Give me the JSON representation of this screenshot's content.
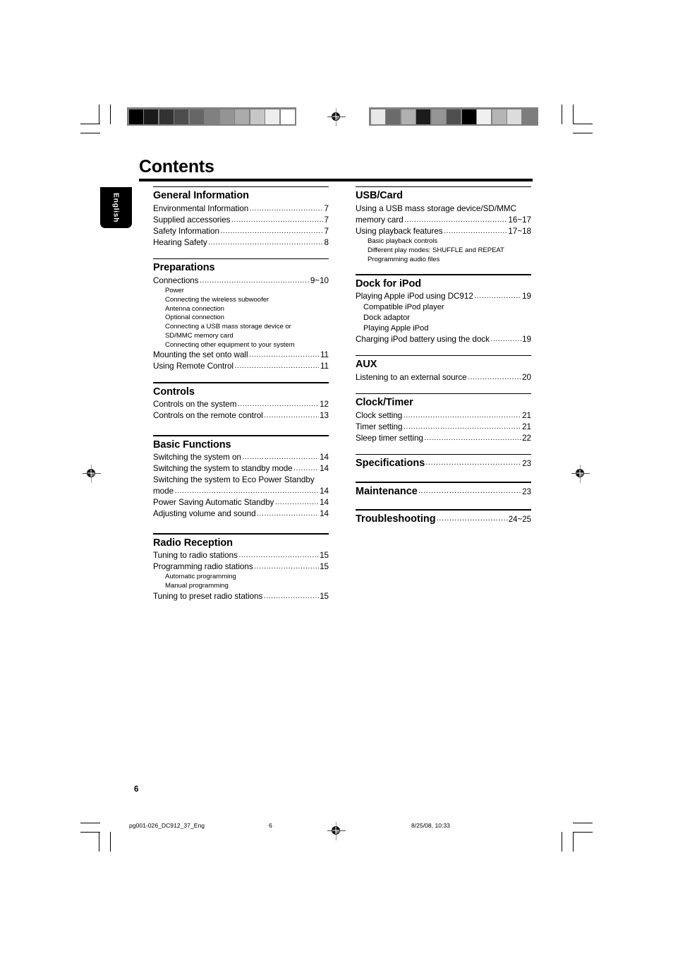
{
  "document": {
    "page_title": "Contents",
    "language_tab": "English",
    "folio": "6"
  },
  "marks": {
    "registration_icon": "registration-target-icon",
    "density_bar_left": [
      "#000000",
      "#1b1b1b",
      "#333333",
      "#4d4d4d",
      "#666666",
      "#808080",
      "#949494",
      "#ababab",
      "#c6c6c6",
      "#ededed",
      "#ffffff"
    ],
    "density_bar_right": [
      "#e8e8e8",
      "#6b6b6b",
      "#b0b0b0",
      "#1c1c1c",
      "#959595",
      "#4f4f4f",
      "#000000",
      "#f0f0f0",
      "#b5b5b5",
      "#dcdcdc",
      "#7d7d7d"
    ]
  },
  "toc": {
    "left_column": [
      {
        "heading": "General Information",
        "entries": [
          {
            "label": "Environmental Information",
            "page": "7"
          },
          {
            "label": "Supplied accessories",
            "page": "7"
          },
          {
            "label": "Safety Information",
            "page": "7"
          },
          {
            "label": "Hearing Safety",
            "page": "8"
          }
        ]
      },
      {
        "heading": "Preparations",
        "entries": [
          {
            "label": "Connections",
            "page": "9~10"
          }
        ],
        "sub_after_first": [
          "Power",
          "Connecting the wireless subwoofer",
          "Antenna connection",
          "Optional connection",
          "Connecting a USB mass storage device or",
          "SD/MMC memory card",
          "Connecting other equipment to your system"
        ],
        "entries_tail": [
          {
            "label": "Mounting the set onto wall",
            "page": "11"
          },
          {
            "label": "Using Remote Control",
            "page": "11"
          }
        ]
      },
      {
        "heading": "Controls",
        "entries": [
          {
            "label": "Controls on the system",
            "page": "12"
          },
          {
            "label": "Controls on the remote control",
            "page": "13"
          }
        ]
      },
      {
        "heading": "Basic Functions",
        "entries": [
          {
            "label": "Switching the system on",
            "page": "14"
          },
          {
            "label": "Switching the system to standby mode",
            "page": "14"
          }
        ],
        "wrapped_entry": {
          "line1": "Switching the system to Eco Power Standby",
          "line2": "mode",
          "page": "14"
        },
        "entries_tail": [
          {
            "label": "Power Saving Automatic Standby",
            "page": "14"
          },
          {
            "label": "Adjusting volume and sound",
            "page": "14"
          }
        ]
      },
      {
        "heading": "Radio Reception",
        "entries": [
          {
            "label": "Tuning to radio stations",
            "page": "15"
          },
          {
            "label": "Programming radio stations",
            "page": "15"
          }
        ],
        "sub_after_second": [
          "Automatic programming",
          "Manual programming"
        ],
        "entries_tail": [
          {
            "label": "Tuning to preset radio stations",
            "page": "15"
          }
        ]
      }
    ],
    "right_column": [
      {
        "heading": "USB/Card",
        "wrapped_entry": {
          "line1": "Using a USB mass storage device/SD/MMC",
          "line2": "memory card",
          "page": "16~17"
        },
        "entries_tail": [
          {
            "label": "Using playback features",
            "page": "17~18"
          }
        ],
        "sub_tail": [
          "Basic playback controls",
          "Different play modes: SHUFFLE and REPEAT",
          "Programming audio files"
        ]
      },
      {
        "heading": "Dock for iPod",
        "entries": [
          {
            "label": "Playing Apple iPod using DC912",
            "page": "19"
          }
        ],
        "sub_after_first": [
          "Compatible iPod player",
          "Dock adaptor",
          "Playing Apple iPod"
        ],
        "entries_tail": [
          {
            "label": "Charging iPod battery using the dock",
            "page": "19"
          }
        ]
      },
      {
        "heading": "AUX",
        "entries": [
          {
            "label": "Listening to an external source",
            "page": "20"
          }
        ]
      },
      {
        "heading": "Clock/Timer",
        "entries": [
          {
            "label": "Clock setting",
            "page": "21"
          },
          {
            "label": "Timer setting",
            "page": "21"
          },
          {
            "label": "Sleep timer setting",
            "page": "22"
          }
        ]
      },
      {
        "heading": "Specifications",
        "heading_page": "23",
        "entries": []
      },
      {
        "heading": "Maintenance",
        "heading_page": "23",
        "entries": []
      },
      {
        "heading": "Troubleshooting",
        "heading_page": "24~25",
        "entries": []
      }
    ]
  },
  "footer": {
    "filename": "pg001-026_DC912_37_Eng",
    "page_number": "6",
    "timestamp": "8/25/08, 10:33"
  }
}
